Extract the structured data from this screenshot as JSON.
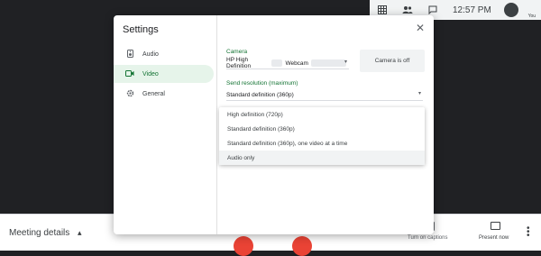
{
  "topbar": {
    "time": "12:57 PM",
    "avatar_label": "You",
    "icons": [
      "grid-icon",
      "people-icon",
      "chat-icon"
    ]
  },
  "bottombar": {
    "meeting_details": "Meeting details",
    "captions": "Turn on captions",
    "present": "Present now"
  },
  "dialog": {
    "title": "Settings",
    "nav": [
      {
        "label": "Audio",
        "icon": "speaker-icon"
      },
      {
        "label": "Video",
        "icon": "video-camera-icon"
      },
      {
        "label": "General",
        "icon": "gear-icon"
      }
    ],
    "active_nav": "Video",
    "camera": {
      "label": "Camera",
      "device_prefix": "HP High Definition",
      "device_suffix": "Webcam",
      "preview_status": "Camera is off"
    },
    "send_resolution": {
      "label": "Send resolution (maximum)",
      "value": "Standard definition (360p)",
      "options": [
        "High definition (720p)",
        "Standard definition (360p)",
        "Standard definition (360p), one video at a time",
        "Audio only"
      ],
      "highlighted_option": "Audio only"
    }
  },
  "colors": {
    "accent_green": "#137333",
    "active_nav_bg": "#e6f4ea",
    "end_call_red": "#ea4335",
    "backdrop": "#202124"
  }
}
